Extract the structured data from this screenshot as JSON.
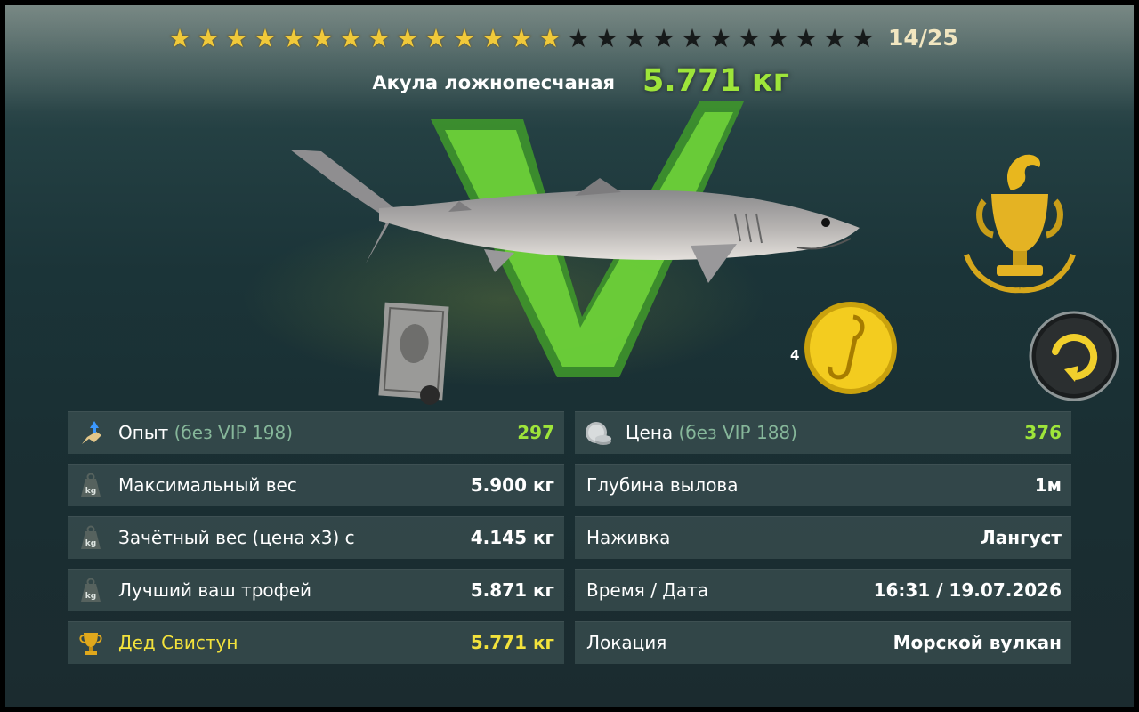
{
  "header": {
    "stars_total": 25,
    "stars_filled": 14,
    "progress": "14/25"
  },
  "fish": {
    "name": "Акула ложнопесчаная",
    "weight": "5.771 кг"
  },
  "coin": {
    "count": "4"
  },
  "colors": {
    "weight_green": "#9ee53a",
    "star_gold": "#f0c93a",
    "record_yellow": "#f3e23c",
    "vip_note": "#86b79a"
  },
  "stats_left": [
    {
      "icon": "experience-icon",
      "label": "Опыт",
      "sub": "(без VIP 198)",
      "value": "297"
    },
    {
      "icon": "weight-icon",
      "label": "Максимальный вес",
      "value": "5.900 кг"
    },
    {
      "icon": "weight-icon",
      "label": "Зачётный вес (цена х3) с",
      "value": "4.145 кг"
    },
    {
      "icon": "weight-icon",
      "label": "Лучший ваш трофей",
      "value": "5.871 кг"
    },
    {
      "icon": "trophy-cup-icon",
      "label": "Дед Свистун",
      "value": "5.771 кг"
    }
  ],
  "stats_right": [
    {
      "icon": "silver-coins-icon",
      "label": "Цена",
      "sub": "(без VIP 188)",
      "value": "376"
    },
    {
      "label": "Глубина вылова",
      "value": "1м"
    },
    {
      "label": "Наживка",
      "value": "Лангуст"
    },
    {
      "label": "Время / Дата",
      "value": "16:31 / 19.07.2026"
    },
    {
      "label": "Локация",
      "value": "Морской вулкан"
    }
  ]
}
